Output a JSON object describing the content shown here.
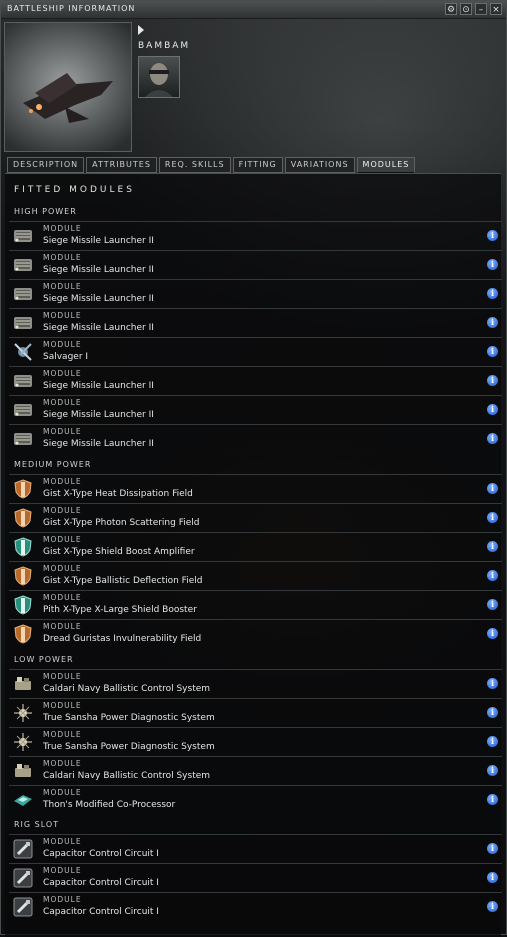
{
  "window": {
    "title": "BATTLESHIP INFORMATION",
    "buttons": [
      "⚙",
      "⊙",
      "–",
      "×"
    ]
  },
  "ship": {
    "name": "BAMBAM"
  },
  "tabs": [
    {
      "label": "DESCRIPTION",
      "active": false
    },
    {
      "label": "ATTRIBUTES",
      "active": false
    },
    {
      "label": "REQ. SKILLS",
      "active": false
    },
    {
      "label": "FITTING",
      "active": false
    },
    {
      "label": "VARIATIONS",
      "active": false
    },
    {
      "label": "MODULES",
      "active": true
    }
  ],
  "panel": {
    "title": "FITTED MODULES"
  },
  "sections": [
    {
      "label": "HIGH POWER",
      "modules": [
        {
          "kind": "MODULE",
          "name": "Siege Missile Launcher II",
          "icon": "launcher-icon"
        },
        {
          "kind": "MODULE",
          "name": "Siege Missile Launcher II",
          "icon": "launcher-icon"
        },
        {
          "kind": "MODULE",
          "name": "Siege Missile Launcher II",
          "icon": "launcher-icon"
        },
        {
          "kind": "MODULE",
          "name": "Siege Missile Launcher II",
          "icon": "launcher-icon"
        },
        {
          "kind": "MODULE",
          "name": "Salvager I",
          "icon": "salvager-icon"
        },
        {
          "kind": "MODULE",
          "name": "Siege Missile Launcher II",
          "icon": "launcher-icon"
        },
        {
          "kind": "MODULE",
          "name": "Siege Missile Launcher II",
          "icon": "launcher-icon"
        },
        {
          "kind": "MODULE",
          "name": "Siege Missile Launcher II",
          "icon": "launcher-icon"
        }
      ]
    },
    {
      "label": "MEDIUM POWER",
      "modules": [
        {
          "kind": "MODULE",
          "name": "Gist X-Type Heat Dissipation Field",
          "icon": "orange-shield-icon"
        },
        {
          "kind": "MODULE",
          "name": "Gist X-Type Photon Scattering Field",
          "icon": "orange-shield-icon"
        },
        {
          "kind": "MODULE",
          "name": "Gist X-Type Shield Boost Amplifier",
          "icon": "teal-shield-icon"
        },
        {
          "kind": "MODULE",
          "name": "Gist X-Type Ballistic Deflection Field",
          "icon": "orange-shield-icon"
        },
        {
          "kind": "MODULE",
          "name": "Pith X-Type X-Large Shield Booster",
          "icon": "teal-shield-icon"
        },
        {
          "kind": "MODULE",
          "name": "Dread Guristas Invulnerability Field",
          "icon": "orange-shield-icon"
        }
      ]
    },
    {
      "label": "LOW POWER",
      "modules": [
        {
          "kind": "MODULE",
          "name": "Caldari Navy Ballistic Control System",
          "icon": "ballistic-control-icon"
        },
        {
          "kind": "MODULE",
          "name": "True Sansha Power Diagnostic System",
          "icon": "power-diagnostic-icon"
        },
        {
          "kind": "MODULE",
          "name": "True Sansha Power Diagnostic System",
          "icon": "power-diagnostic-icon"
        },
        {
          "kind": "MODULE",
          "name": "Caldari Navy Ballistic Control System",
          "icon": "ballistic-control-icon"
        },
        {
          "kind": "MODULE",
          "name": "Thon's Modified Co-Processor",
          "icon": "co-processor-icon"
        }
      ]
    },
    {
      "label": "RIG SLOT",
      "modules": [
        {
          "kind": "MODULE",
          "name": "Capacitor Control Circuit I",
          "icon": "rig-icon"
        },
        {
          "kind": "MODULE",
          "name": "Capacitor Control Circuit I",
          "icon": "rig-icon"
        },
        {
          "kind": "MODULE",
          "name": "Capacitor Control Circuit I",
          "icon": "rig-icon"
        }
      ]
    }
  ],
  "info_glyph": "i"
}
